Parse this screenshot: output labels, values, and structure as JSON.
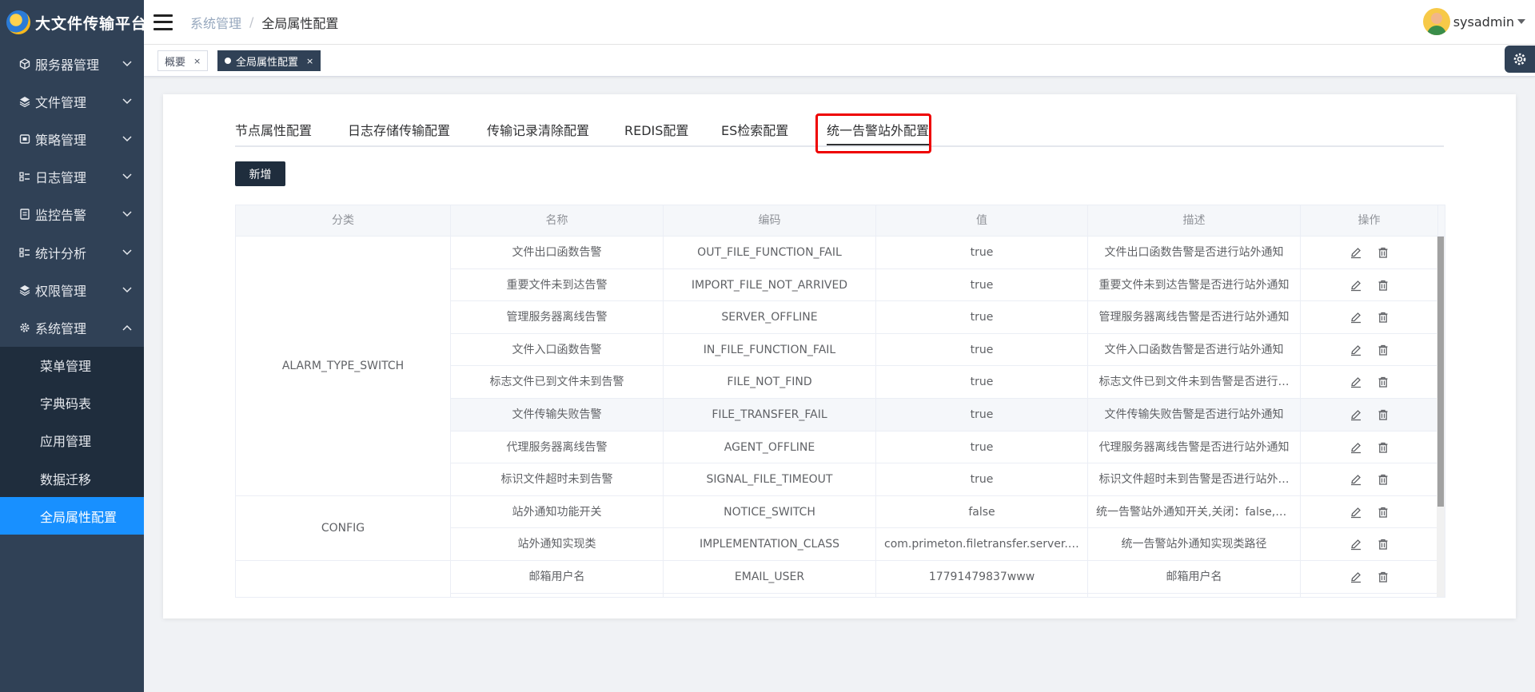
{
  "app": {
    "title": "大文件传输平台"
  },
  "sidebar": {
    "items": [
      {
        "label": "服务器管理",
        "icon": "cube-icon",
        "expanded": false
      },
      {
        "label": "文件管理",
        "icon": "layers-icon",
        "expanded": false
      },
      {
        "label": "策略管理",
        "icon": "box-icon",
        "expanded": false
      },
      {
        "label": "日志管理",
        "icon": "list-icon",
        "expanded": false
      },
      {
        "label": "监控告警",
        "icon": "monitor-icon",
        "expanded": false
      },
      {
        "label": "统计分析",
        "icon": "chart-list-icon",
        "expanded": false
      },
      {
        "label": "权限管理",
        "icon": "layers-icon",
        "expanded": false
      },
      {
        "label": "系统管理",
        "icon": "gear-icon",
        "expanded": true
      }
    ],
    "submenu": [
      {
        "label": "菜单管理"
      },
      {
        "label": "字典码表"
      },
      {
        "label": "应用管理"
      },
      {
        "label": "数据迁移"
      },
      {
        "label": "全局属性配置",
        "active": true
      }
    ]
  },
  "header": {
    "breadcrumb": [
      "系统管理",
      "全局属性配置"
    ],
    "username": "sysadmin"
  },
  "tagsbar": {
    "tags": [
      {
        "label": "概要",
        "active": false
      },
      {
        "label": "全局属性配置",
        "active": true
      }
    ],
    "close_glyph": "×"
  },
  "tabs": [
    {
      "label": "节点属性配置"
    },
    {
      "label": "日志存储传输配置"
    },
    {
      "label": "传输记录清除配置"
    },
    {
      "label": "REDIS配置"
    },
    {
      "label": "ES检索配置"
    },
    {
      "label": "统一告警站外配置",
      "active": true
    }
  ],
  "toolbar": {
    "add_label": "新增"
  },
  "table": {
    "columns": [
      "分类",
      "名称",
      "编码",
      "值",
      "描述",
      "操作"
    ],
    "groups": [
      {
        "label": "ALARM_TYPE_SWITCH",
        "rows": 8
      },
      {
        "label": "CONFIG",
        "rows": 2
      },
      {
        "label": "",
        "rows": 2
      }
    ],
    "rows": [
      {
        "name": "文件出口函数告警",
        "code": "OUT_FILE_FUNCTION_FAIL",
        "value": "true",
        "desc": "文件出口函数告警是否进行站外通知"
      },
      {
        "name": "重要文件未到达告警",
        "code": "IMPORT_FILE_NOT_ARRIVED",
        "value": "true",
        "desc": "重要文件未到达告警是否进行站外通知"
      },
      {
        "name": "管理服务器离线告警",
        "code": "SERVER_OFFLINE",
        "value": "true",
        "desc": "管理服务器离线告警是否进行站外通知"
      },
      {
        "name": "文件入口函数告警",
        "code": "IN_FILE_FUNCTION_FAIL",
        "value": "true",
        "desc": "文件入口函数告警是否进行站外通知"
      },
      {
        "name": "标志文件已到文件未到告警",
        "code": "FILE_NOT_FIND",
        "value": "true",
        "desc": "标志文件已到文件未到告警是否进行…"
      },
      {
        "name": "文件传输失败告警",
        "code": "FILE_TRANSFER_FAIL",
        "value": "true",
        "desc": "文件传输失败告警是否进行站外通知"
      },
      {
        "name": "代理服务器离线告警",
        "code": "AGENT_OFFLINE",
        "value": "true",
        "desc": "代理服务器离线告警是否进行站外通知"
      },
      {
        "name": "标识文件超时未到告警",
        "code": "SIGNAL_FILE_TIMEOUT",
        "value": "true",
        "desc": "标识文件超时未到告警是否进行站外…"
      },
      {
        "name": "站外通知功能开关",
        "code": "NOTICE_SWITCH",
        "value": "false",
        "desc": "统一告警站外通知开关,关闭：false,开…"
      },
      {
        "name": "站外通知实现类",
        "code": "IMPLEMENTATION_CLASS",
        "value": "com.primeton.filetransfer.server.servi…",
        "desc": "统一告警站外通知实现类路径"
      },
      {
        "name": "邮箱用户名",
        "code": "EMAIL_USER",
        "value": "17791479837www",
        "desc": "邮箱用户名"
      },
      {
        "name": "",
        "code": "",
        "value": "",
        "desc": ""
      }
    ]
  }
}
